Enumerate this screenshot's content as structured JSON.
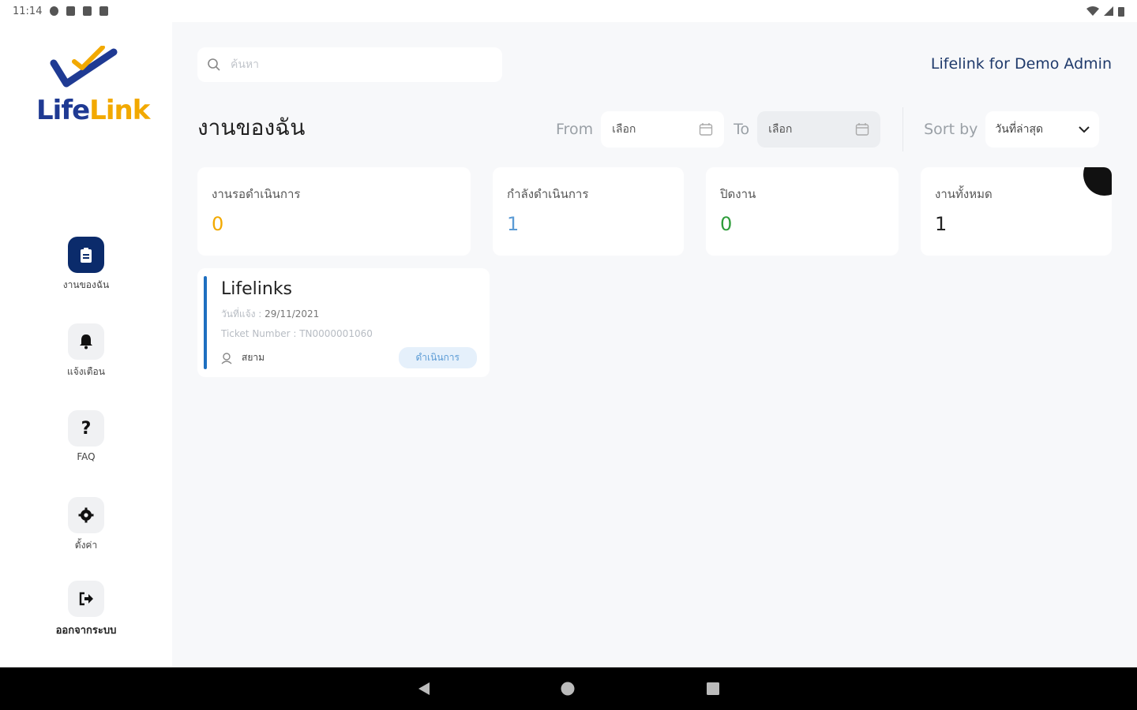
{
  "status_bar": {
    "time": "11:14"
  },
  "brand": {
    "life": "Life",
    "link": "Link",
    "navy": "#1f3a93",
    "gold": "#f2a900"
  },
  "sidebar": {
    "items": [
      {
        "label": "งานของฉัน",
        "icon": "clipboard-icon",
        "active": true
      },
      {
        "label": "แจ้งเตือน",
        "icon": "bell-icon",
        "active": false
      },
      {
        "label": "FAQ",
        "icon": "question-icon",
        "active": false
      },
      {
        "label": "ตั้งค่า",
        "icon": "gear-icon",
        "active": false
      },
      {
        "label": "ออกจากระบบ",
        "icon": "logout-icon",
        "active": false
      }
    ]
  },
  "header": {
    "search_placeholder": "ค้นหา",
    "user_name": "Lifelink for Demo Admin"
  },
  "page": {
    "title": "งานของฉัน",
    "from_label": "From",
    "from_value": "เลือก",
    "to_label": "To",
    "to_value": "เลือก",
    "sort_label": "Sort by",
    "sort_value": "วันที่ล่าสุด"
  },
  "stats": [
    {
      "label": "งานรอดำเนินการ",
      "value": "0",
      "color": "#f2a900"
    },
    {
      "label": "กำลังดำเนินการ",
      "value": "1",
      "color": "#5b9bd5"
    },
    {
      "label": "ปิดงาน",
      "value": "0",
      "color": "#2e9d3a"
    },
    {
      "label": "งานทั้งหมด",
      "value": "1",
      "color": "#222222"
    }
  ],
  "ticket": {
    "title": "Lifelinks",
    "date_label": "วันที่แจ้ง : ",
    "date_value": "29/11/2021",
    "number_label": "Ticket Number : ",
    "number_value": "TN0000001060",
    "user": "สยาม",
    "status": "ดำเนินการ"
  }
}
